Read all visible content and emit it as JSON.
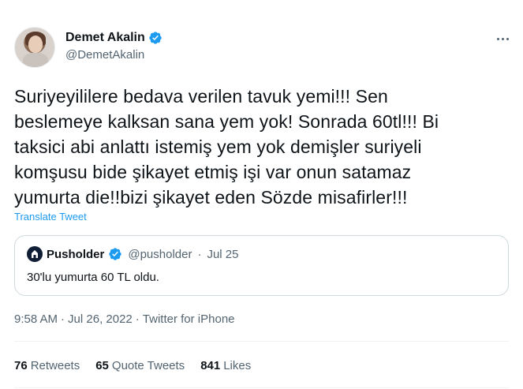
{
  "author": {
    "display_name": "Demet Akalin",
    "handle": "@DemetAkalin",
    "verified": true
  },
  "tweet": {
    "text": "Suriyeyililere bedava verilen tavuk yemi!!! Sen\nbeslemeye kalksan sana yem yok! Sonrada 60tl!!! Bi\ntaksici abi anlattı istemiş yem yok demişler suriyeli\nkomşusu bide şikayet etmiş işi var onun satamaz\nyumurta die!!bizi şikayet eden Sözde misafirler!!!",
    "translate_label": "Translate Tweet",
    "time": "9:58 AM",
    "separator": "·",
    "date": "Jul 26, 2022",
    "source": "Twitter for iPhone"
  },
  "quote": {
    "display_name": "Pusholder",
    "handle": "@pusholder",
    "separator": "·",
    "date": "Jul 25",
    "text": "30'lu yumurta 60 TL oldu."
  },
  "stats": {
    "retweets_count": "76",
    "retweets_label": "Retweets",
    "quote_tweets_count": "65",
    "quote_tweets_label": "Quote Tweets",
    "likes_count": "841",
    "likes_label": "Likes"
  },
  "colors": {
    "accent": "#1d9bf0",
    "secondary_text": "#536471",
    "primary_text": "#0f1419",
    "border": "#cfd9de"
  },
  "icons": {
    "verified": "verified-badge-icon",
    "more": "more-options-icon"
  }
}
